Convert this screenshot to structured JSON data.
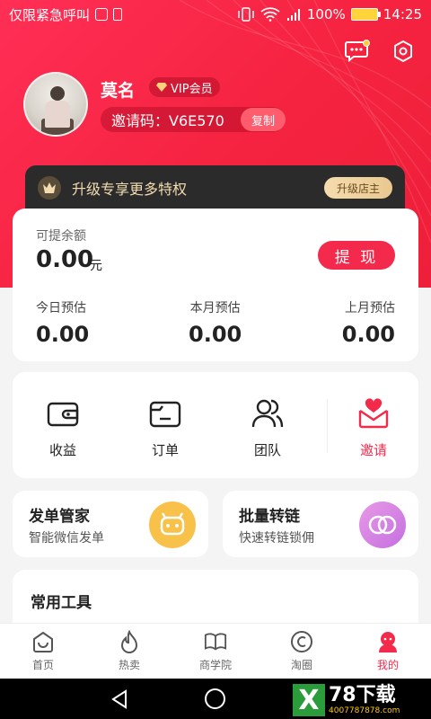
{
  "status_bar": {
    "carrier": "仅限紧急呼叫",
    "battery": "100%",
    "time": "14:25"
  },
  "header": {
    "icons": [
      "message-icon",
      "settings-icon"
    ],
    "user": {
      "name": "莫名",
      "vip_label": "VIP会员",
      "invite_code": "邀请码：V6E570",
      "copy_label": "复制"
    },
    "upgrade": {
      "text": "升级专享更多特权",
      "button": "升级店主"
    }
  },
  "balance": {
    "label": "可提余额",
    "amount": "0.00",
    "unit": "元",
    "withdraw_label": "提 现",
    "estimates": [
      {
        "label": "今日预估",
        "value": "0.00"
      },
      {
        "label": "本月预估",
        "value": "0.00"
      },
      {
        "label": "上月预估",
        "value": "0.00"
      }
    ]
  },
  "quick_nav": [
    {
      "label": "收益",
      "icon": "wallet-icon"
    },
    {
      "label": "订单",
      "icon": "order-icon"
    },
    {
      "label": "团队",
      "icon": "team-icon"
    },
    {
      "label": "邀请",
      "icon": "invite-icon"
    }
  ],
  "promos": [
    {
      "title": "发单管家",
      "subtitle": "智能微信发单",
      "color": "#f7c14a"
    },
    {
      "title": "批量转链",
      "subtitle": "快速转链锁佣",
      "color": "#d77be6"
    }
  ],
  "tools": {
    "title": "常用工具"
  },
  "tabbar": [
    {
      "label": "首页",
      "icon": "home-icon"
    },
    {
      "label": "热卖",
      "icon": "fire-icon"
    },
    {
      "label": "商学院",
      "icon": "book-icon"
    },
    {
      "label": "淘圈",
      "icon": "copyright-icon"
    },
    {
      "label": "我的",
      "icon": "profile-icon"
    }
  ],
  "watermark": {
    "mark": "X",
    "main": "78下载",
    "sub": "4007787878.com"
  },
  "colors": {
    "brand_red": "#f42a4c",
    "upgrade_gold": "#f3dcb0"
  }
}
